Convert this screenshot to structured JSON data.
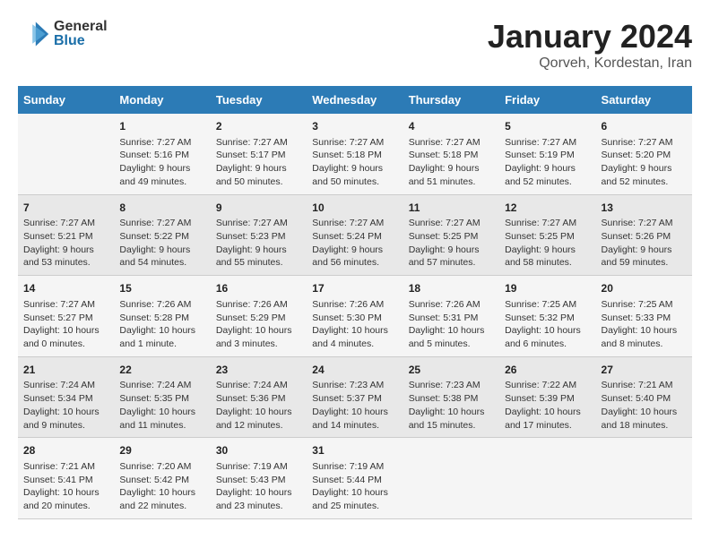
{
  "header": {
    "logo_general": "General",
    "logo_blue": "Blue",
    "title": "January 2024",
    "subtitle": "Qorveh, Kordestan, Iran"
  },
  "weekdays": [
    "Sunday",
    "Monday",
    "Tuesday",
    "Wednesday",
    "Thursday",
    "Friday",
    "Saturday"
  ],
  "weeks": [
    [
      {
        "day": "",
        "sunrise": "",
        "sunset": "",
        "daylight": ""
      },
      {
        "day": "1",
        "sunrise": "Sunrise: 7:27 AM",
        "sunset": "Sunset: 5:16 PM",
        "daylight": "Daylight: 9 hours and 49 minutes."
      },
      {
        "day": "2",
        "sunrise": "Sunrise: 7:27 AM",
        "sunset": "Sunset: 5:17 PM",
        "daylight": "Daylight: 9 hours and 50 minutes."
      },
      {
        "day": "3",
        "sunrise": "Sunrise: 7:27 AM",
        "sunset": "Sunset: 5:18 PM",
        "daylight": "Daylight: 9 hours and 50 minutes."
      },
      {
        "day": "4",
        "sunrise": "Sunrise: 7:27 AM",
        "sunset": "Sunset: 5:18 PM",
        "daylight": "Daylight: 9 hours and 51 minutes."
      },
      {
        "day": "5",
        "sunrise": "Sunrise: 7:27 AM",
        "sunset": "Sunset: 5:19 PM",
        "daylight": "Daylight: 9 hours and 52 minutes."
      },
      {
        "day": "6",
        "sunrise": "Sunrise: 7:27 AM",
        "sunset": "Sunset: 5:20 PM",
        "daylight": "Daylight: 9 hours and 52 minutes."
      }
    ],
    [
      {
        "day": "7",
        "sunrise": "Sunrise: 7:27 AM",
        "sunset": "Sunset: 5:21 PM",
        "daylight": "Daylight: 9 hours and 53 minutes."
      },
      {
        "day": "8",
        "sunrise": "Sunrise: 7:27 AM",
        "sunset": "Sunset: 5:22 PM",
        "daylight": "Daylight: 9 hours and 54 minutes."
      },
      {
        "day": "9",
        "sunrise": "Sunrise: 7:27 AM",
        "sunset": "Sunset: 5:23 PM",
        "daylight": "Daylight: 9 hours and 55 minutes."
      },
      {
        "day": "10",
        "sunrise": "Sunrise: 7:27 AM",
        "sunset": "Sunset: 5:24 PM",
        "daylight": "Daylight: 9 hours and 56 minutes."
      },
      {
        "day": "11",
        "sunrise": "Sunrise: 7:27 AM",
        "sunset": "Sunset: 5:25 PM",
        "daylight": "Daylight: 9 hours and 57 minutes."
      },
      {
        "day": "12",
        "sunrise": "Sunrise: 7:27 AM",
        "sunset": "Sunset: 5:25 PM",
        "daylight": "Daylight: 9 hours and 58 minutes."
      },
      {
        "day": "13",
        "sunrise": "Sunrise: 7:27 AM",
        "sunset": "Sunset: 5:26 PM",
        "daylight": "Daylight: 9 hours and 59 minutes."
      }
    ],
    [
      {
        "day": "14",
        "sunrise": "Sunrise: 7:27 AM",
        "sunset": "Sunset: 5:27 PM",
        "daylight": "Daylight: 10 hours and 0 minutes."
      },
      {
        "day": "15",
        "sunrise": "Sunrise: 7:26 AM",
        "sunset": "Sunset: 5:28 PM",
        "daylight": "Daylight: 10 hours and 1 minute."
      },
      {
        "day": "16",
        "sunrise": "Sunrise: 7:26 AM",
        "sunset": "Sunset: 5:29 PM",
        "daylight": "Daylight: 10 hours and 3 minutes."
      },
      {
        "day": "17",
        "sunrise": "Sunrise: 7:26 AM",
        "sunset": "Sunset: 5:30 PM",
        "daylight": "Daylight: 10 hours and 4 minutes."
      },
      {
        "day": "18",
        "sunrise": "Sunrise: 7:26 AM",
        "sunset": "Sunset: 5:31 PM",
        "daylight": "Daylight: 10 hours and 5 minutes."
      },
      {
        "day": "19",
        "sunrise": "Sunrise: 7:25 AM",
        "sunset": "Sunset: 5:32 PM",
        "daylight": "Daylight: 10 hours and 6 minutes."
      },
      {
        "day": "20",
        "sunrise": "Sunrise: 7:25 AM",
        "sunset": "Sunset: 5:33 PM",
        "daylight": "Daylight: 10 hours and 8 minutes."
      }
    ],
    [
      {
        "day": "21",
        "sunrise": "Sunrise: 7:24 AM",
        "sunset": "Sunset: 5:34 PM",
        "daylight": "Daylight: 10 hours and 9 minutes."
      },
      {
        "day": "22",
        "sunrise": "Sunrise: 7:24 AM",
        "sunset": "Sunset: 5:35 PM",
        "daylight": "Daylight: 10 hours and 11 minutes."
      },
      {
        "day": "23",
        "sunrise": "Sunrise: 7:24 AM",
        "sunset": "Sunset: 5:36 PM",
        "daylight": "Daylight: 10 hours and 12 minutes."
      },
      {
        "day": "24",
        "sunrise": "Sunrise: 7:23 AM",
        "sunset": "Sunset: 5:37 PM",
        "daylight": "Daylight: 10 hours and 14 minutes."
      },
      {
        "day": "25",
        "sunrise": "Sunrise: 7:23 AM",
        "sunset": "Sunset: 5:38 PM",
        "daylight": "Daylight: 10 hours and 15 minutes."
      },
      {
        "day": "26",
        "sunrise": "Sunrise: 7:22 AM",
        "sunset": "Sunset: 5:39 PM",
        "daylight": "Daylight: 10 hours and 17 minutes."
      },
      {
        "day": "27",
        "sunrise": "Sunrise: 7:21 AM",
        "sunset": "Sunset: 5:40 PM",
        "daylight": "Daylight: 10 hours and 18 minutes."
      }
    ],
    [
      {
        "day": "28",
        "sunrise": "Sunrise: 7:21 AM",
        "sunset": "Sunset: 5:41 PM",
        "daylight": "Daylight: 10 hours and 20 minutes."
      },
      {
        "day": "29",
        "sunrise": "Sunrise: 7:20 AM",
        "sunset": "Sunset: 5:42 PM",
        "daylight": "Daylight: 10 hours and 22 minutes."
      },
      {
        "day": "30",
        "sunrise": "Sunrise: 7:19 AM",
        "sunset": "Sunset: 5:43 PM",
        "daylight": "Daylight: 10 hours and 23 minutes."
      },
      {
        "day": "31",
        "sunrise": "Sunrise: 7:19 AM",
        "sunset": "Sunset: 5:44 PM",
        "daylight": "Daylight: 10 hours and 25 minutes."
      },
      {
        "day": "",
        "sunrise": "",
        "sunset": "",
        "daylight": ""
      },
      {
        "day": "",
        "sunrise": "",
        "sunset": "",
        "daylight": ""
      },
      {
        "day": "",
        "sunrise": "",
        "sunset": "",
        "daylight": ""
      }
    ]
  ]
}
